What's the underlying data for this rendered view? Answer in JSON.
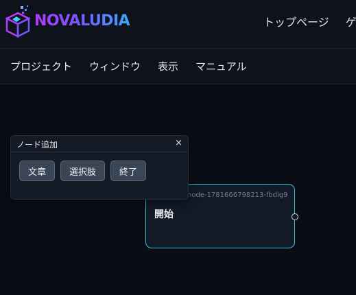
{
  "brand": {
    "name": "NOVALUDIA"
  },
  "topnav": {
    "items": [
      "トップページ",
      "ゲ"
    ]
  },
  "menubar": {
    "items": [
      "プロジェクト",
      "ウィンドウ",
      "表示",
      "マニュアル"
    ]
  },
  "panel": {
    "title": "ノード追加",
    "close": "×",
    "buttons": [
      "文章",
      "選択肢",
      "終了"
    ]
  },
  "node": {
    "id": "node-1781666798213-fbdig9",
    "title": "開始"
  },
  "colors": {
    "background": "#0a0d14",
    "header": "#0e121a",
    "accent": "#3bc4dc",
    "brand_gradient_start": "#b23cff",
    "brand_gradient_end": "#3aa8ff"
  }
}
